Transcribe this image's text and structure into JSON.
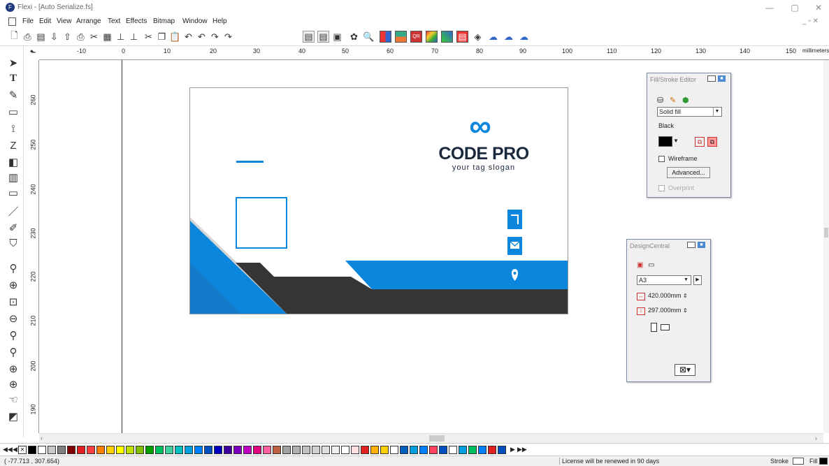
{
  "window": {
    "title": "Flexi - [Auto Serialize.fs]",
    "controls": {
      "minimize": "—",
      "restore": "▢",
      "close": "✕"
    },
    "mdi_controls": "_ ▫ ✕"
  },
  "menu": [
    "File",
    "Edit",
    "View",
    "Arrange",
    "Text",
    "Effects",
    "Bitmap",
    "Window",
    "Help"
  ],
  "ruler": {
    "unit": "millimeters",
    "h_labels": [
      "-10",
      "0",
      "10",
      "20",
      "30",
      "40",
      "50",
      "60",
      "70",
      "80",
      "90",
      "100",
      "110",
      "120",
      "130",
      "140",
      "150"
    ],
    "v_labels": [
      "260",
      "250",
      "240",
      "230",
      "220",
      "210",
      "200",
      "190"
    ]
  },
  "design": {
    "brand": "CODE PRO",
    "slogan": "your tag slogan",
    "logo_symbol": "∞",
    "icons": [
      "phone-icon",
      "mail-icon",
      "location-pin-icon"
    ],
    "colors": {
      "blue": "#0a86dc",
      "dark": "#363636",
      "light_gray": "#d5d5d5",
      "navy_text": "#1a2a3c"
    }
  },
  "fill_stroke": {
    "title": "Fill/Stroke Editor",
    "fill_type": "Solid fill",
    "color_name": "Black",
    "wireframe_label": "Wireframe",
    "advanced_label": "Advanced...",
    "overprint_label": "Overprint"
  },
  "design_central": {
    "title": "DesignCentral",
    "size_preset": "A3",
    "width": "420.000mm",
    "height": "297.000mm"
  },
  "status": {
    "coords": "( -77.713 , 307.654)",
    "license": "License will be renewed in 90 days",
    "stroke_label": "Stroke",
    "fill_label": "Fill"
  }
}
